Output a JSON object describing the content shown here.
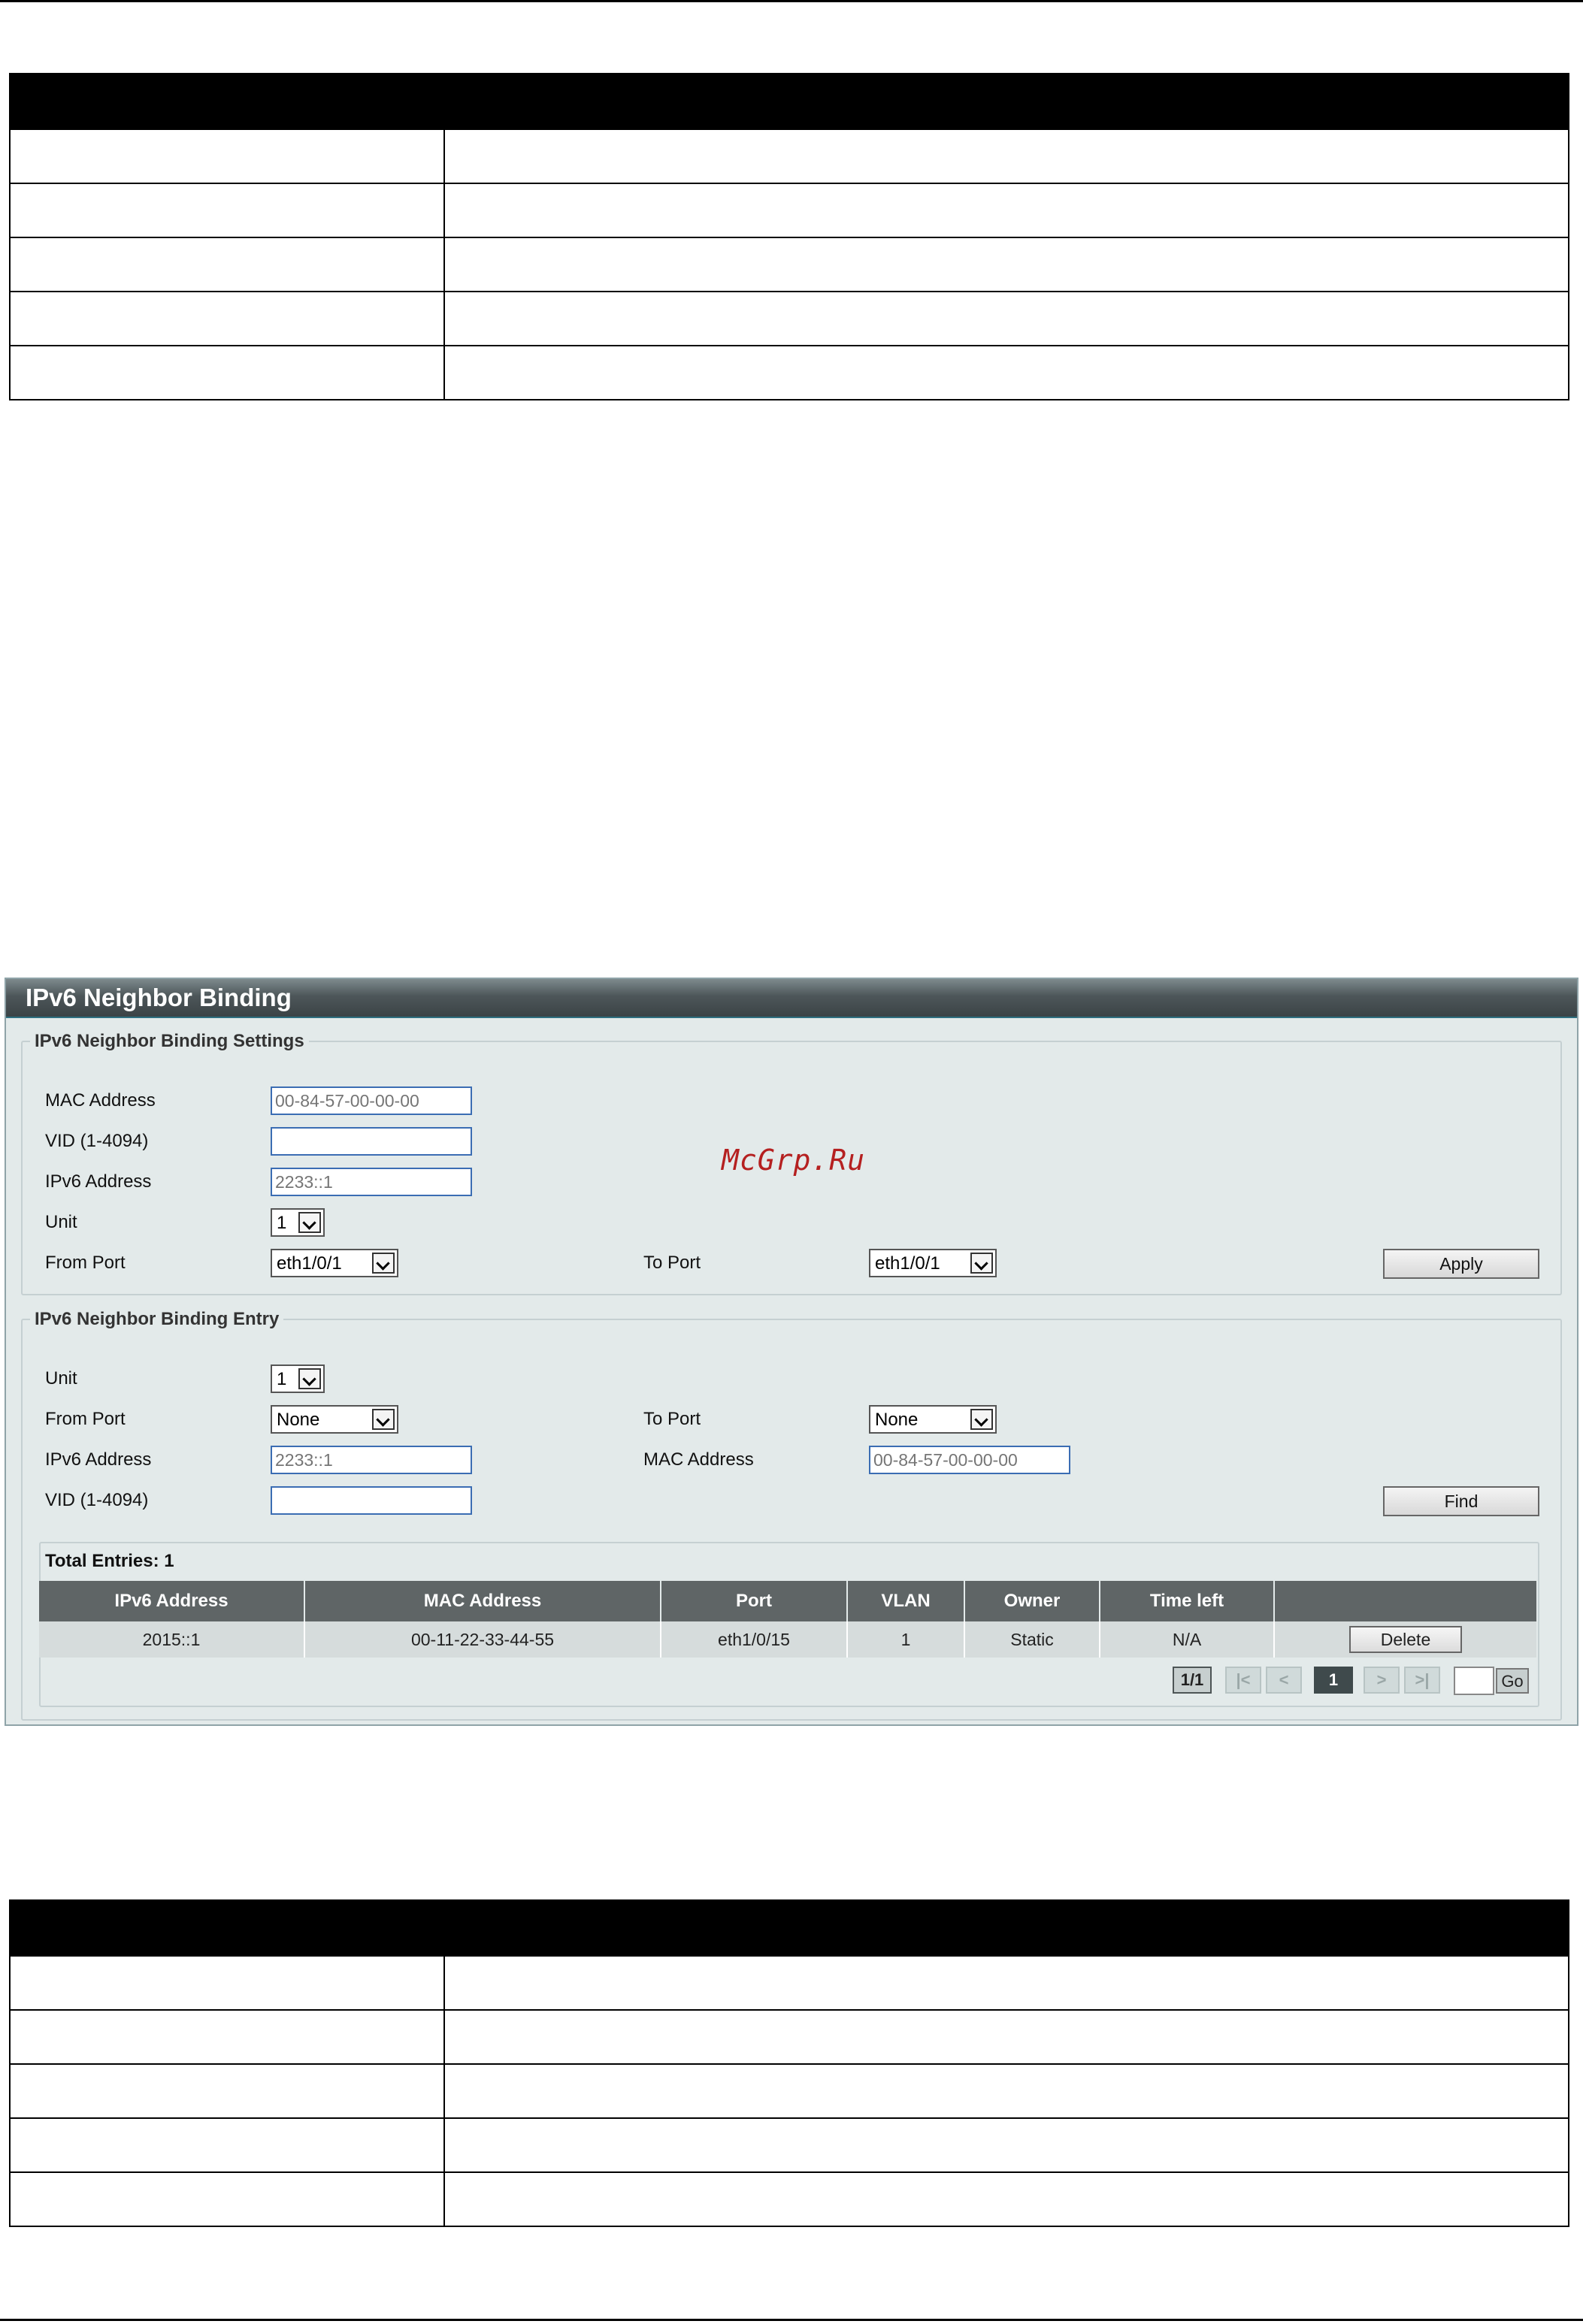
{
  "panel": {
    "title": "IPv6 Neighbor Binding",
    "watermark": "McGrp.Ru"
  },
  "settings": {
    "legend": "IPv6 Neighbor Binding Settings",
    "mac_label": "MAC Address",
    "mac_placeholder": "00-84-57-00-00-00",
    "vid_label": "VID (1-4094)",
    "vid_value": "",
    "ipv6_label": "IPv6 Address",
    "ipv6_placeholder": "2233::1",
    "unit_label": "Unit",
    "unit_value": "1",
    "from_port_label": "From Port",
    "from_port_value": "eth1/0/1",
    "to_port_label": "To Port",
    "to_port_value": "eth1/0/1",
    "apply_label": "Apply"
  },
  "entry": {
    "legend": "IPv6 Neighbor Binding Entry",
    "unit_label": "Unit",
    "unit_value": "1",
    "from_port_label": "From Port",
    "from_port_value": "None",
    "to_port_label": "To Port",
    "to_port_value": "None",
    "ipv6_label": "IPv6 Address",
    "ipv6_placeholder": "2233::1",
    "mac_label": "MAC Address",
    "mac_placeholder": "00-84-57-00-00-00",
    "vid_label": "VID (1-4094)",
    "find_label": "Find"
  },
  "results": {
    "total": "Total Entries: 1",
    "columns": [
      "IPv6 Address",
      "MAC Address",
      "Port",
      "VLAN",
      "Owner",
      "Time left",
      ""
    ],
    "rows": [
      {
        "ipv6": "2015::1",
        "mac": "00-11-22-33-44-55",
        "port": "eth1/0/15",
        "vlan": "1",
        "owner": "Static",
        "time_left": "N/A",
        "action": "Delete"
      }
    ]
  },
  "pagination": {
    "page_info": "1/1",
    "first": "|<",
    "prev": "<",
    "current": "1",
    "next": ">",
    "last": ">|",
    "go_label": "Go"
  }
}
